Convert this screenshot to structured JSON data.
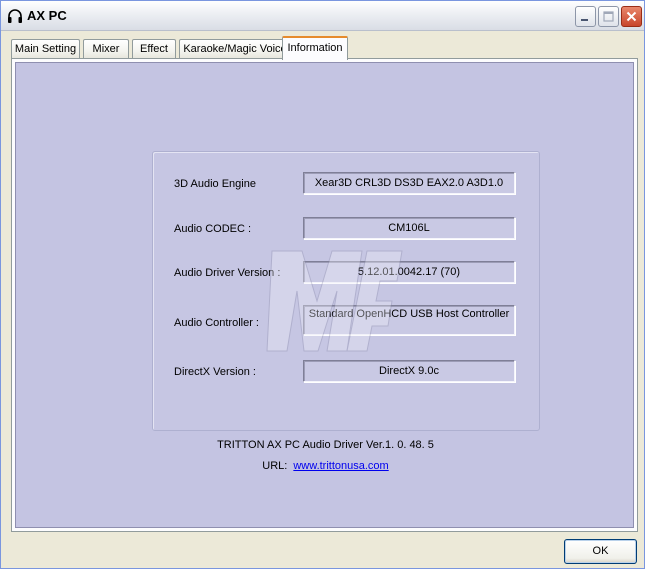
{
  "window": {
    "title": "AX PC"
  },
  "tabs": [
    {
      "label": "Main Setting",
      "active": false
    },
    {
      "label": "Mixer",
      "active": false
    },
    {
      "label": "Effect",
      "active": false
    },
    {
      "label": "Karaoke/Magic Voice",
      "active": false
    },
    {
      "label": "Information",
      "active": true
    }
  ],
  "info": {
    "audio_engine": {
      "label": "3D Audio Engine",
      "value": "Xear3D  CRL3D  DS3D  EAX2.0  A3D1.0"
    },
    "audio_codec": {
      "label": "Audio CODEC :",
      "value": "CM106L"
    },
    "driver_version": {
      "label": "Audio Driver Version :",
      "value": "5.12.01.0042.17 (70)"
    },
    "controller": {
      "label": "Audio Controller :",
      "value": "Standard OpenHCD USB Host Controller"
    },
    "directx": {
      "label": "DirectX Version :",
      "value": "DirectX 9.0c"
    }
  },
  "footer": {
    "driver_text": "TRITTON AX PC Audio Driver Ver.1. 0. 48. 5",
    "url_label": "URL:",
    "url_text": "www.trittonusa.com"
  },
  "buttons": {
    "ok_label": "OK"
  },
  "colors": {
    "panel_bg": "#c4c4e2",
    "active_tab_accent": "#e68b2c",
    "link": "#0000ee"
  }
}
